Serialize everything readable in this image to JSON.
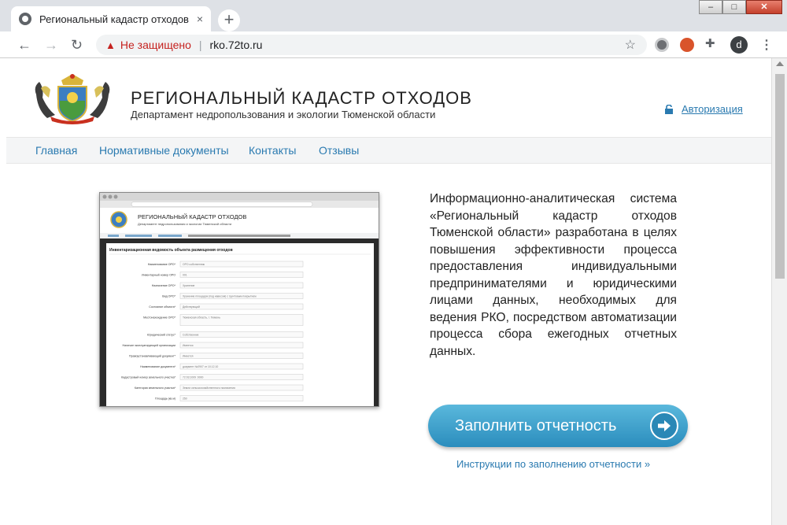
{
  "browser": {
    "tab_title": "Региональный кадастр отходов",
    "tab_close": "×",
    "new_tab": "+",
    "security_label": "Не защищено",
    "address": "rko.72to.ru",
    "profile_initial": "d",
    "window_controls": {
      "minimize": "–",
      "maximize": "□",
      "close": "✕"
    }
  },
  "header": {
    "title": "РЕГИОНАЛЬНЫЙ КАДАСТР ОТХОДОВ",
    "subtitle": "Департамент недропользования и экологии Тюменской области",
    "auth_link": "Авторизация"
  },
  "nav": {
    "items": [
      "Главная",
      "Нормативные документы",
      "Контакты",
      "Отзывы"
    ]
  },
  "main": {
    "description": "Информационно-аналитическая система «Региональный кадастр отходов Тюменской области» разработана в целях повышения эффективности процесса предоставления индивидуальными предпринимателями и юридическими лицами данных, необходимых для ведения РКО, посредством автоматизации процесса сбора ежегодных отчетных данных.",
    "cta_label": "Заполнить отчетность",
    "instructions_link": "Инструкции по заполнению отчетности »"
  },
  "preview": {
    "site_title": "РЕГИОНАЛЬНЫЙ КАДАСТР ОТХОДОВ",
    "site_subtitle": "Департамент недропользования и экологии Тюменской области",
    "form_title": "Инвентаризационная ведомость объекта размещения отходов",
    "fields": [
      {
        "label": "Наименование ОРО*",
        "value": "ОРО собственник"
      },
      {
        "label": "Инвентарный номер ОРО",
        "value": "001"
      },
      {
        "label": "Назначение ОРО*",
        "value": "Хранение"
      },
      {
        "label": "Вид ОРО*",
        "value": "Хранение площадок (под навесом) с грунтовым покрытием"
      },
      {
        "label": "Состояние объекта*",
        "value": "Действующий"
      },
      {
        "label": "Местонахождение ОРО*",
        "value": "Тюменская область, г. Тюмень"
      },
      {
        "label": "Юридический статус*",
        "value": "Собственник"
      },
      {
        "label": "Наличие эксплуатирующей организации",
        "value": "Имеется"
      },
      {
        "label": "Правоустанавливающий документ*",
        "value": "Имеется"
      },
      {
        "label": "Наименование документа*",
        "value": "документ №0907 от 10.12.10"
      },
      {
        "label": "Кадастровый номер земельного участка*",
        "value": "72:03:1009 :0000"
      },
      {
        "label": "Категория земельного участка*",
        "value": "Земли сельскохозяйственного назначения"
      },
      {
        "label": "Площадь (кв.м)",
        "value": "250"
      }
    ]
  }
}
